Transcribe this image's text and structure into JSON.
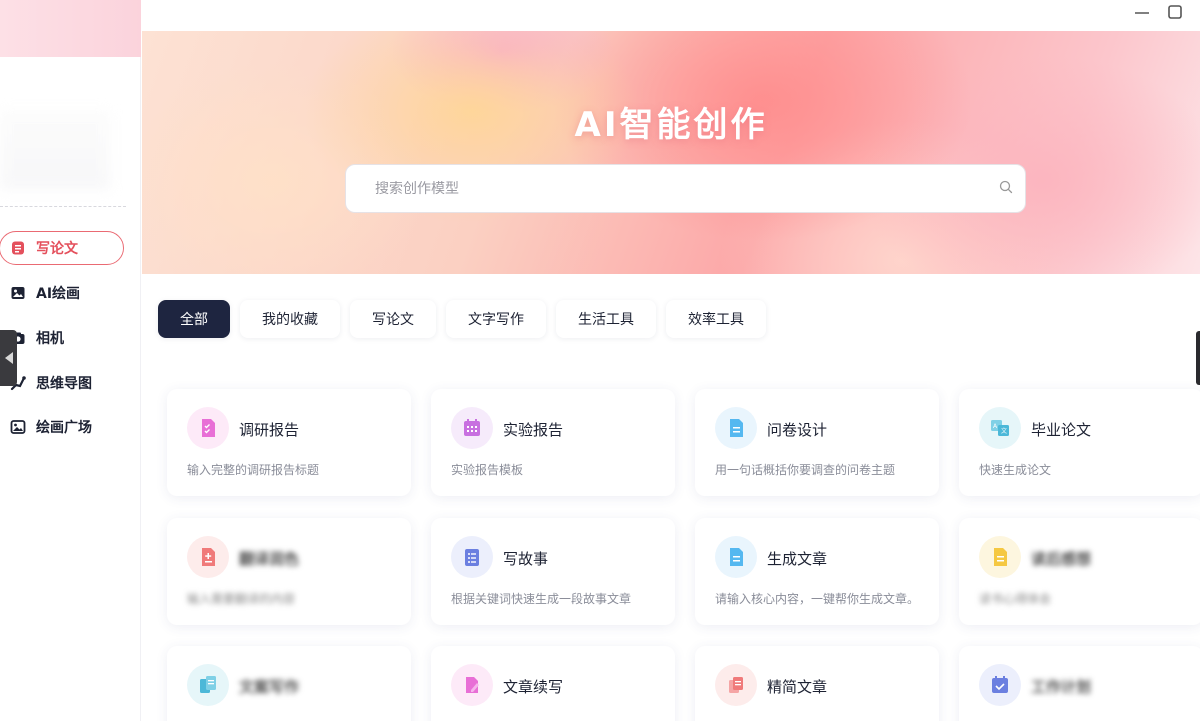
{
  "hero": {
    "title": "AI智能创作",
    "search_placeholder": "搜索创作模型"
  },
  "sidebar": {
    "items": [
      {
        "label": "写论文",
        "icon": "document-icon",
        "active": true
      },
      {
        "label": "AI绘画",
        "icon": "image-icon",
        "active": false
      },
      {
        "label": "相机",
        "icon": "camera-icon",
        "active": false
      },
      {
        "label": "思维导图",
        "icon": "mindmap-icon",
        "active": false
      },
      {
        "label": "绘画广场",
        "icon": "gallery-icon",
        "active": false
      }
    ]
  },
  "tabs": [
    {
      "label": "全部",
      "active": true
    },
    {
      "label": "我的收藏",
      "active": false
    },
    {
      "label": "写论文",
      "active": false
    },
    {
      "label": "文字写作",
      "active": false
    },
    {
      "label": "生活工具",
      "active": false
    },
    {
      "label": "效率工具",
      "active": false
    }
  ],
  "cards": [
    {
      "title": "调研报告",
      "desc": "输入完整的调研报告标题",
      "icon": "checklist-icon",
      "color": "#e86fd6"
    },
    {
      "title": "实验报告",
      "desc": "实验报告模板",
      "icon": "calendar-grid-icon",
      "color": "#c870e0"
    },
    {
      "title": "问卷设计",
      "desc": "用一句话概括你要调查的问卷主题",
      "icon": "doc-lines-icon",
      "color": "#55b8f0"
    },
    {
      "title": "毕业论文",
      "desc": "快速生成论文",
      "icon": "translate-doc-icon",
      "color": "#4cb8d8"
    },
    {
      "title": "翻译润色",
      "desc": "输入需要翻译的内容",
      "icon": "doc-plus-icon",
      "color": "#f07a7a",
      "blurred": true
    },
    {
      "title": "写故事",
      "desc": "根据关键词快速生成一段故事文章",
      "icon": "list-icon",
      "color": "#6b7fe0"
    },
    {
      "title": "生成文章",
      "desc": "请输入核心内容，一键帮你生成文章。",
      "icon": "doc-lines-icon",
      "color": "#55b8f0"
    },
    {
      "title": "读后感想",
      "desc": "读书心得体会",
      "icon": "doc-lines-icon",
      "color": "#f5c842",
      "blurred": true
    },
    {
      "title": "文案写作",
      "desc": "",
      "icon": "doc-copy-icon",
      "color": "#4cb8d8",
      "blurred": true
    },
    {
      "title": "文章续写",
      "desc": "",
      "icon": "pen-doc-icon",
      "color": "#e86fd6"
    },
    {
      "title": "精简文章",
      "desc": "",
      "icon": "stack-doc-icon",
      "color": "#f07a7a"
    },
    {
      "title": "工作计划",
      "desc": "",
      "icon": "calendar-check-icon",
      "color": "#6b7fe0",
      "blurred": true
    }
  ]
}
